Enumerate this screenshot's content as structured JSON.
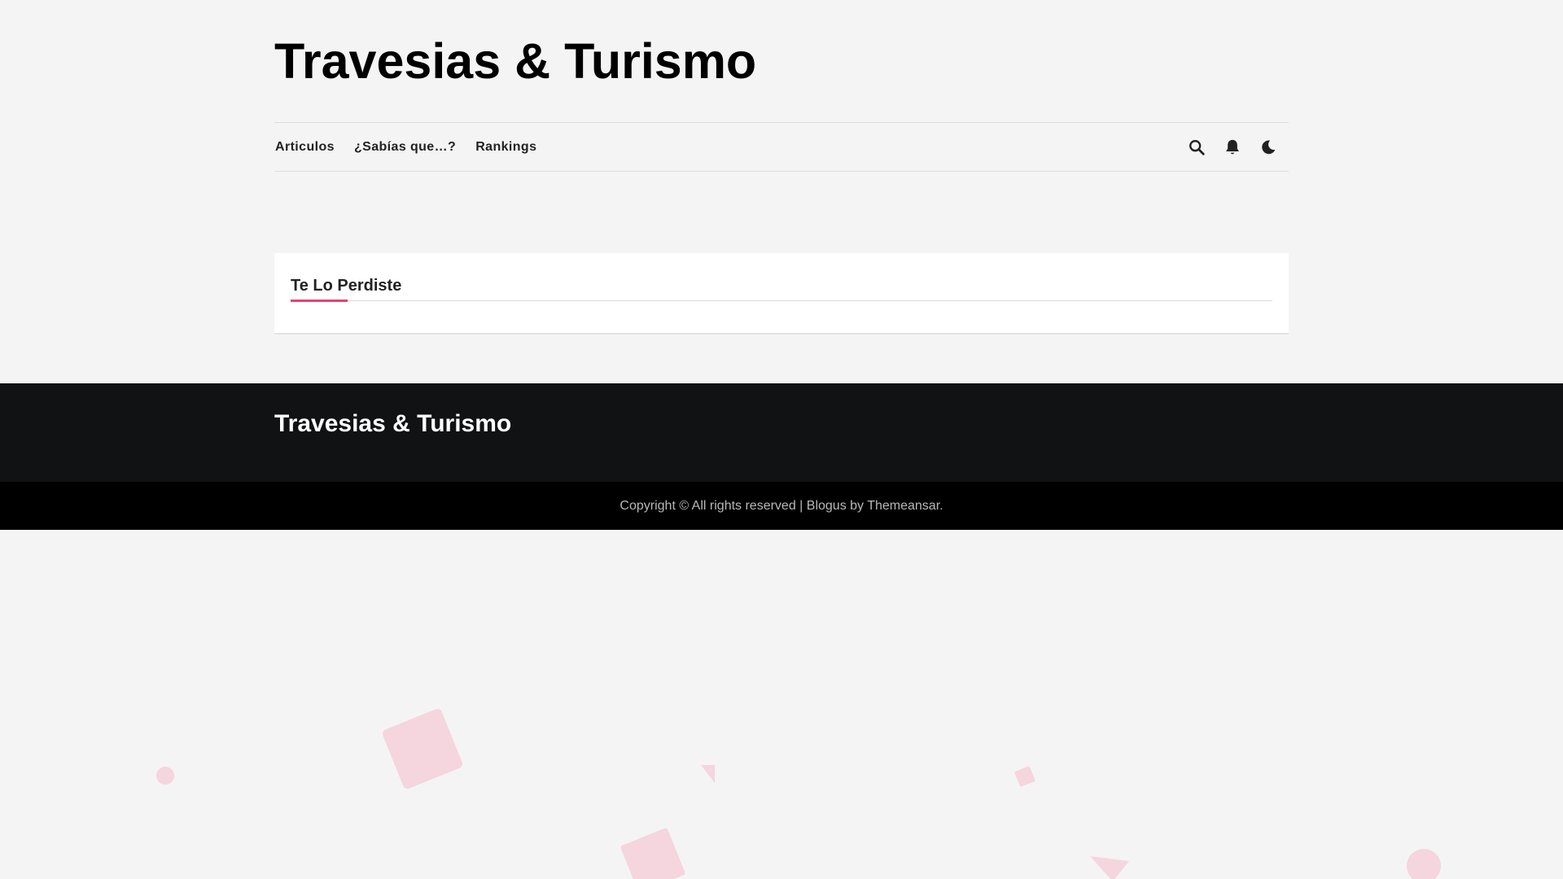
{
  "header": {
    "site_title": "Travesias & Turismo"
  },
  "nav": {
    "items": [
      {
        "label": "Articulos"
      },
      {
        "label": "¿Sabías que…?"
      },
      {
        "label": "Rankings"
      }
    ],
    "tools": [
      {
        "icon": "search-icon"
      },
      {
        "icon": "bell-icon"
      },
      {
        "icon": "moon-icon"
      }
    ]
  },
  "missed_section": {
    "title": "Te Lo Perdiste"
  },
  "footer": {
    "site_title": "Travesias & Turismo",
    "copyright_prefix": "Copyright © All rights reserved | ",
    "theme_link": "Blogus",
    "by_text": " by ",
    "author_link": "Themeansar",
    "suffix": "."
  },
  "colors": {
    "accent": "#e8436a",
    "footer_bg": "#111214",
    "footer_bottom_bg": "#000000",
    "page_bg": "#f4f4f4",
    "decor_shape": "#f5d5de"
  }
}
